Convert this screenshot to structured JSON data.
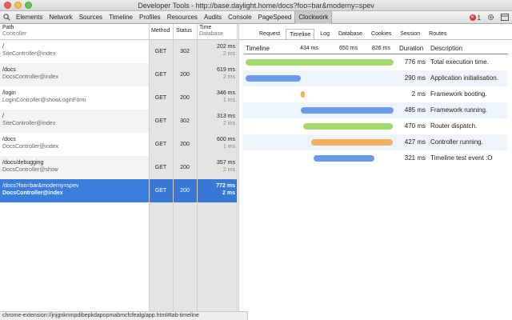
{
  "window": {
    "title": "Developer Tools - http://base.daylight.home/docs?foo=bar&moderny=spev"
  },
  "toolbar": {
    "tabs": [
      "Elements",
      "Network",
      "Sources",
      "Timeline",
      "Profiles",
      "Resources",
      "Audits",
      "Console",
      "PageSpeed",
      "Clockwork"
    ],
    "active_tab": "Clockwork",
    "error_count": "1"
  },
  "requests": {
    "headers": {
      "path": "Path",
      "path_sub": "Controller",
      "method": "Method",
      "status": "Status",
      "time": "Time",
      "time_sub": "Database"
    },
    "rows": [
      {
        "path": "/",
        "controller": "SiteController@index",
        "method": "GET",
        "status": "302",
        "time": "202 ms",
        "db": "2 ms"
      },
      {
        "path": "/docs",
        "controller": "DocsController@index",
        "method": "GET",
        "status": "200",
        "time": "619 ms",
        "db": "2 ms"
      },
      {
        "path": "/login",
        "controller": "LoginController@showLoginForm",
        "method": "GET",
        "status": "200",
        "time": "346 ms",
        "db": "1 ms"
      },
      {
        "path": "/",
        "controller": "SiteController@index",
        "method": "GET",
        "status": "302",
        "time": "313 ms",
        "db": "2 ms"
      },
      {
        "path": "/docs",
        "controller": "DocsController@index",
        "method": "GET",
        "status": "200",
        "time": "600 ms",
        "db": "1 ms"
      },
      {
        "path": "/docs/debugging",
        "controller": "DocsController@show",
        "method": "GET",
        "status": "200",
        "time": "357 ms",
        "db": "2 ms"
      },
      {
        "path": "/docs?foo=bar&moderny=spev",
        "controller": "DocsController@index",
        "method": "GET",
        "status": "200",
        "time": "772 ms",
        "db": "2 ms"
      }
    ],
    "selected_index": 6
  },
  "status_bar": {
    "text": "chrome-extension://jnjgnknmpdibepkdapopmabmcfcfealg/app.html#tab-timeline"
  },
  "panel": {
    "tabs": [
      "Request",
      "Timeline",
      "Log",
      "Database",
      "Cookies",
      "Session",
      "Routes"
    ],
    "active_tab": "Timeline"
  },
  "timeline": {
    "headers": {
      "timeline": "Timeline",
      "duration": "Duration",
      "description": "Description"
    },
    "ticks": [
      "434 ms",
      "650 ms",
      "826 ms"
    ],
    "total_ms": 776,
    "colors": {
      "green": "#a3d86e",
      "blue": "#6b9be8",
      "orange": "#f0b05e"
    },
    "events": [
      {
        "start": 0,
        "duration": 776,
        "color": "green",
        "duration_label": "776 ms",
        "description": "Total execution time."
      },
      {
        "start": 0,
        "duration": 290,
        "color": "blue",
        "duration_label": "290 ms",
        "description": "Application initialisation."
      },
      {
        "start": 290,
        "duration": 2,
        "color": "orange",
        "duration_label": "2 ms",
        "description": "Framework booting."
      },
      {
        "start": 291,
        "duration": 485,
        "color": "blue",
        "duration_label": "485 ms",
        "description": "Framework running."
      },
      {
        "start": 302,
        "duration": 470,
        "color": "green",
        "duration_label": "470 ms",
        "description": "Router dispatch."
      },
      {
        "start": 345,
        "duration": 427,
        "color": "orange",
        "duration_label": "427 ms",
        "description": "Controller running."
      },
      {
        "start": 355,
        "duration": 321,
        "color": "blue",
        "duration_label": "321 ms",
        "description": "Timeline test event :O"
      }
    ]
  }
}
